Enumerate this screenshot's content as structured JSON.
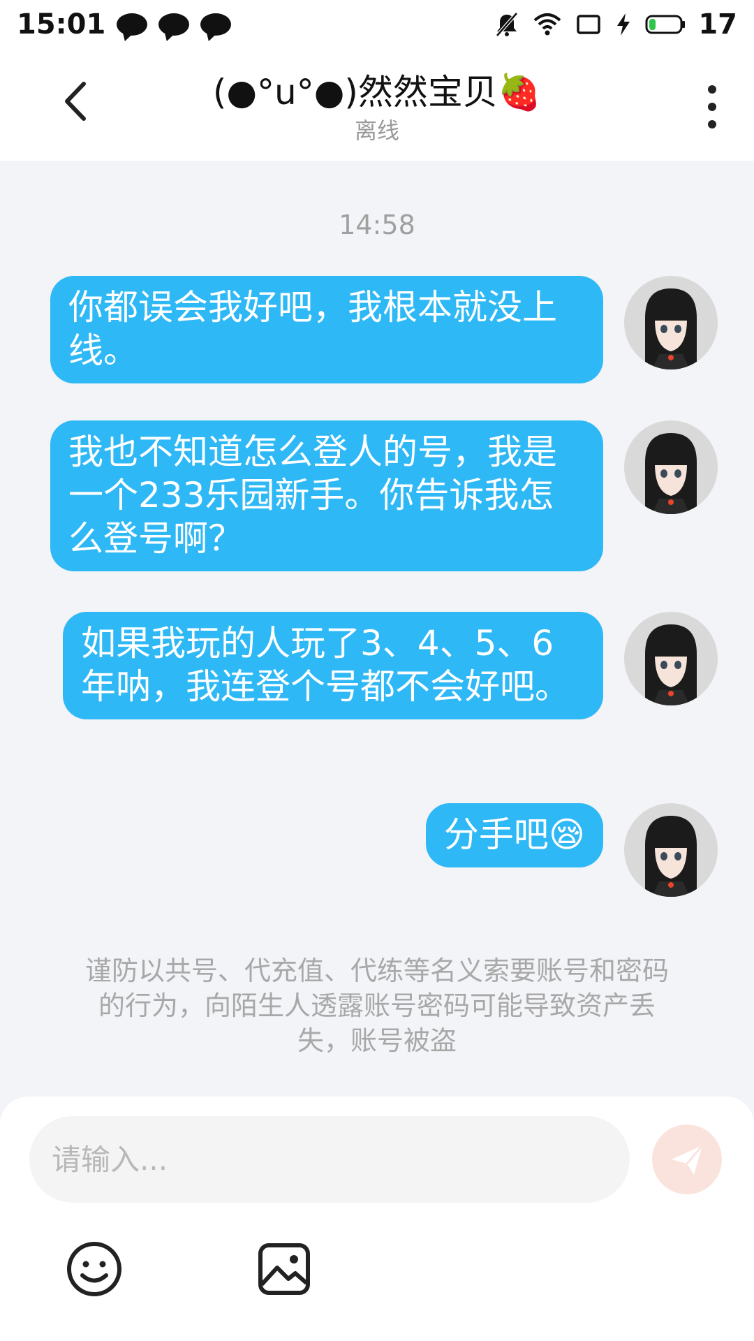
{
  "status_bar": {
    "time": "15:01",
    "battery_level": "17",
    "icons": [
      "message-icon",
      "message-icon",
      "message-icon",
      "mute-icon",
      "wifi-icon",
      "rotate-icon",
      "charging-icon",
      "battery-icon"
    ]
  },
  "header": {
    "title": "(●°u°●)然然宝贝🍓",
    "subtitle": "离线",
    "back_icon": "chevron-left-icon",
    "more_icon": "more-vertical-icon"
  },
  "chat": {
    "timestamp": "14:58",
    "messages": [
      {
        "text": "你都误会我好吧，我根本就没上线。"
      },
      {
        "text": "我也不知道怎么登人的号，我是一个233乐园新手。你告诉我怎么登号啊？"
      },
      {
        "text": "如果我玩的人玩了3、4、5、6年呐，我连登个号都不会好吧。"
      },
      {
        "text": "分手吧😪"
      }
    ]
  },
  "notice": "谨防以共号、代充值、代练等名义索要账号和密码的行为，向陌生人透露账号密码可能导致资产丢失，账号被盗",
  "input": {
    "placeholder": "请输入...",
    "value": ""
  },
  "toolbar": {
    "emoji_icon": "emoji-icon",
    "image_icon": "image-icon",
    "send_icon": "send-icon"
  },
  "colors": {
    "bubble": "#2eb8f5",
    "background": "#f3f4f8",
    "send_button": "#fbe3dd"
  }
}
